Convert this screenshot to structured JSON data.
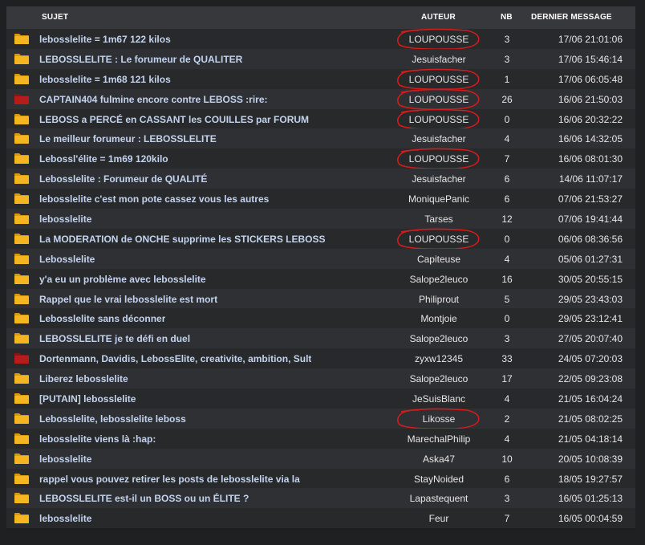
{
  "headers": {
    "subject": "SUJET",
    "author": "AUTEUR",
    "count": "NB",
    "last_message": "DERNIER MESSAGE"
  },
  "colors": {
    "folder_yellow": "#f3b620",
    "folder_red": "#b71c1c",
    "circle_red": "#d31b1b"
  },
  "topics": [
    {
      "subject": "lebosslelite = 1m67 122 kilos",
      "author": "LOUPOUSSE",
      "count": "3",
      "date": "17/06 21:01:06",
      "folder": "yellow",
      "circled": true
    },
    {
      "subject": "LEBOSSLELITE : Le forumeur de QUALITER",
      "author": "Jesuisfacher",
      "count": "3",
      "date": "17/06 15:46:14",
      "folder": "yellow",
      "circled": false
    },
    {
      "subject": "lebosslelite = 1m68 121 kilos",
      "author": "LOUPOUSSE",
      "count": "1",
      "date": "17/06 06:05:48",
      "folder": "yellow",
      "circled": true
    },
    {
      "subject": "CAPTAIN404 fulmine encore contre LEBOSS :rire:",
      "author": "LOUPOUSSE",
      "count": "26",
      "date": "16/06 21:50:03",
      "folder": "red",
      "circled": true
    },
    {
      "subject": "LEBOSS a PERCÉ en CASSANT les COUILLES par FORUM",
      "author": "LOUPOUSSE",
      "count": "0",
      "date": "16/06 20:32:22",
      "folder": "yellow",
      "circled": true
    },
    {
      "subject": "Le meilleur forumeur : LEBOSSLELITE",
      "author": "Jesuisfacher",
      "count": "4",
      "date": "16/06 14:32:05",
      "folder": "yellow",
      "circled": false
    },
    {
      "subject": "Lebossl'élite = 1m69 120kilo",
      "author": "LOUPOUSSE",
      "count": "7",
      "date": "16/06 08:01:30",
      "folder": "yellow",
      "circled": true
    },
    {
      "subject": "Lebosslelite : Forumeur de QUALITÉ",
      "author": "Jesuisfacher",
      "count": "6",
      "date": "14/06 11:07:17",
      "folder": "yellow",
      "circled": false
    },
    {
      "subject": "lebosslelite c'est mon pote cassez vous les autres",
      "author": "MoniquePanic",
      "count": "6",
      "date": "07/06 21:53:27",
      "folder": "yellow",
      "circled": false
    },
    {
      "subject": "lebosslelite",
      "author": "Tarses",
      "count": "12",
      "date": "07/06 19:41:44",
      "folder": "yellow",
      "circled": false
    },
    {
      "subject": "La MODERATION de ONCHE supprime les STICKERS LEBOSS",
      "author": "LOUPOUSSE",
      "count": "0",
      "date": "06/06 08:36:56",
      "folder": "yellow",
      "circled": true
    },
    {
      "subject": "Lebosslelite",
      "author": "Capiteuse",
      "count": "4",
      "date": "05/06 01:27:31",
      "folder": "yellow",
      "circled": false
    },
    {
      "subject": "y'a eu un problème avec lebosslelite",
      "author": "Salope2leuco",
      "count": "16",
      "date": "30/05 20:55:15",
      "folder": "yellow",
      "circled": false
    },
    {
      "subject": "Rappel que le vrai lebosslelite est mort",
      "author": "Philiprout",
      "count": "5",
      "date": "29/05 23:43:03",
      "folder": "yellow",
      "circled": false
    },
    {
      "subject": "Lebosslelite sans déconner",
      "author": "Montjoie",
      "count": "0",
      "date": "29/05 23:12:41",
      "folder": "yellow",
      "circled": false
    },
    {
      "subject": "LEBOSSLELITE je te défi en duel",
      "author": "Salope2leuco",
      "count": "3",
      "date": "27/05 20:07:40",
      "folder": "yellow",
      "circled": false
    },
    {
      "subject": "Dortenmann, Davidis, LebossElite, creativite, ambition, Sult",
      "author": "zyxw12345",
      "count": "33",
      "date": "24/05 07:20:03",
      "folder": "red",
      "circled": false
    },
    {
      "subject": "Liberez lebosslelite",
      "author": "Salope2leuco",
      "count": "17",
      "date": "22/05 09:23:08",
      "folder": "yellow",
      "circled": false
    },
    {
      "subject": "[PUTAIN] lebosslelite",
      "author": "JeSuisBlanc",
      "count": "4",
      "date": "21/05 16:04:24",
      "folder": "yellow",
      "circled": false
    },
    {
      "subject": "Lebosslelite, lebosslelite leboss",
      "author": "Likosse",
      "count": "2",
      "date": "21/05 08:02:25",
      "folder": "yellow",
      "circled": true
    },
    {
      "subject": "lebosslelite viens là :hap:",
      "author": "MarechalPhilip",
      "count": "4",
      "date": "21/05 04:18:14",
      "folder": "yellow",
      "circled": false
    },
    {
      "subject": "lebosslelite",
      "author": "Aska47",
      "count": "10",
      "date": "20/05 10:08:39",
      "folder": "yellow",
      "circled": false
    },
    {
      "subject": "rappel vous pouvez retirer les posts de lebosslelite via la",
      "author": "StayNoided",
      "count": "6",
      "date": "18/05 19:27:57",
      "folder": "yellow",
      "circled": false
    },
    {
      "subject": "LEBOSSLELITE est-il un BOSS ou un ÉLITE ?",
      "author": "Lapastequent",
      "count": "3",
      "date": "16/05 01:25:13",
      "folder": "yellow",
      "circled": false
    },
    {
      "subject": "lebosslelite",
      "author": "Feur",
      "count": "7",
      "date": "16/05 00:04:59",
      "folder": "yellow",
      "circled": false
    }
  ]
}
